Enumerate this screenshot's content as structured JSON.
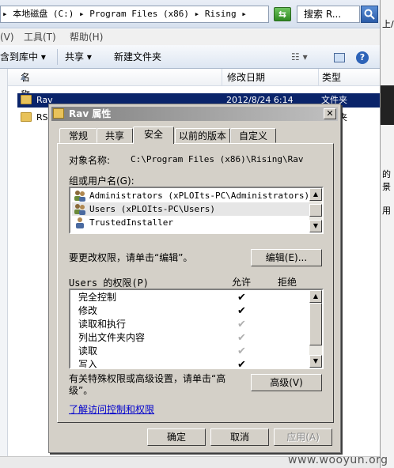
{
  "explorer": {
    "address_path": "▸ 本地磁盘 (C:) ▸ Program Files (x86) ▸ Rising ▸",
    "search_placeholder": "搜索 R...",
    "menu": [
      "(V)",
      "工具(T)",
      "帮助(H)"
    ],
    "toolbar": {
      "include_library": "含到库中",
      "share": "共享",
      "new_folder": "新建文件夹"
    },
    "columns": [
      "名称",
      "修改日期",
      "类型"
    ],
    "files": [
      {
        "name": "Rav",
        "date": "2012/8/24 6:14",
        "type": "文件夹"
      },
      {
        "name": "RSD",
        "date": "",
        "type": "文件夹"
      }
    ],
    "right_sliver_texts": [
      "上/",
      "的景",
      "用"
    ],
    "watermark": "www.wooyun.org"
  },
  "dialog": {
    "title": "Rav 属性",
    "tabs": [
      "常规",
      "共享",
      "安全",
      "以前的版本",
      "自定义"
    ],
    "active_tab": "安全",
    "object_name_label": "对象名称:",
    "object_name_value": "C:\\Program Files (x86)\\Rising\\Rav",
    "groups_label": "组或用户名(G):",
    "groups": [
      "Administrators (xPLOIts-PC\\Administrators)",
      "Users (xPLOIts-PC\\Users)",
      "TrustedInstaller"
    ],
    "change_hint": "要更改权限，请单击“编辑”。",
    "edit_button": "编辑(E)...",
    "perm_header": "Users 的权限(P)",
    "allow_label": "允许",
    "deny_label": "拒绝",
    "permissions": [
      {
        "name": "完全控制",
        "allow": "✔",
        "allow_style": "dark"
      },
      {
        "name": "修改",
        "allow": "✔",
        "allow_style": "dark"
      },
      {
        "name": "读取和执行",
        "allow": "✔",
        "allow_style": "grey"
      },
      {
        "name": "列出文件夹内容",
        "allow": "✔",
        "allow_style": "grey"
      },
      {
        "name": "读取",
        "allow": "✔",
        "allow_style": "grey"
      },
      {
        "name": "写入",
        "allow": "✔",
        "allow_style": "dark"
      }
    ],
    "special_hint": "有关特殊权限或高级设置，请单击“高级”。",
    "advanced_button": "高级(V)",
    "learn_link": "了解访问控制和权限",
    "ok_button": "确定",
    "cancel_button": "取消",
    "apply_button": "应用(A)"
  }
}
